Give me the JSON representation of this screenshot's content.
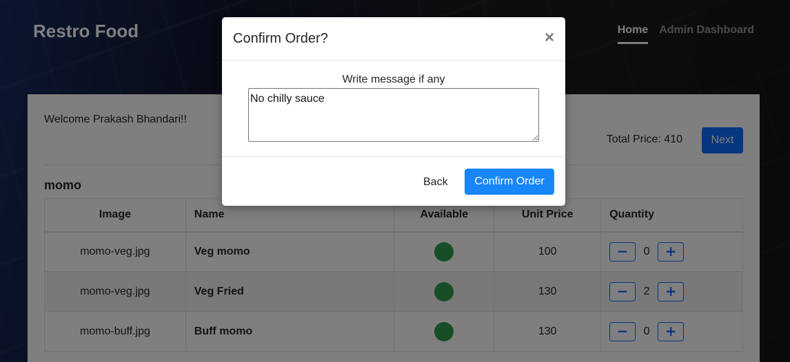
{
  "app": {
    "brand": "Restro Food",
    "nav": [
      {
        "label": "Home",
        "active": true
      },
      {
        "label": "Admin Dashboard",
        "active": false
      }
    ]
  },
  "main": {
    "welcome": "Welcome Prakash Bhandari!!",
    "total_price": "Total Price: 410",
    "next_label": "Next",
    "category": "momo",
    "table": {
      "headers": [
        "Image",
        "Name",
        "Available",
        "Unit Price",
        "Quantity"
      ],
      "rows": [
        {
          "image": "momo-veg.jpg",
          "name": "Veg momo",
          "available": true,
          "price": "100",
          "qty": "0"
        },
        {
          "image": "momo-veg.jpg",
          "name": "Veg Fried",
          "available": true,
          "price": "130",
          "qty": "2"
        },
        {
          "image": "momo-buff.jpg",
          "name": "Buff momo",
          "available": true,
          "price": "130",
          "qty": "0"
        }
      ],
      "minus_glyph": "−",
      "plus_glyph": "+"
    }
  },
  "modal": {
    "title": "Confirm Order?",
    "close_glyph": "×",
    "message_label": "Write message if any",
    "message_value": "No chilly sauce",
    "back_label": "Back",
    "confirm_label": "Confirm Order"
  },
  "colors": {
    "primary": "#0d6efd",
    "available": "#2e9d4a"
  }
}
